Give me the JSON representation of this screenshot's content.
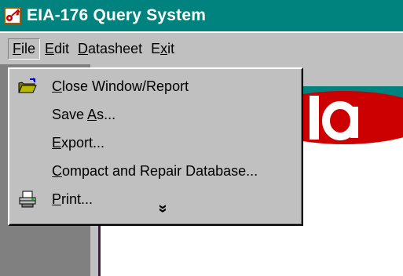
{
  "window": {
    "title": "EIA-176 Query System",
    "icon": "key-icon"
  },
  "menubar": {
    "items": [
      {
        "label_pre": "",
        "mnemonic": "F",
        "label_post": "ile",
        "active": true
      },
      {
        "label_pre": "",
        "mnemonic": "E",
        "label_post": "dit",
        "active": false
      },
      {
        "label_pre": "",
        "mnemonic": "D",
        "label_post": "atasheet",
        "active": false
      },
      {
        "label_pre": "E",
        "mnemonic": "x",
        "label_post": "it",
        "active": false
      }
    ]
  },
  "file_menu": {
    "items": [
      {
        "icon": "open-folder-icon",
        "label_pre": "",
        "mnemonic": "C",
        "label_post": "lose Window/Report"
      },
      {
        "icon": "",
        "label_pre": "Save ",
        "mnemonic": "A",
        "label_post": "s..."
      },
      {
        "icon": "",
        "label_pre": "",
        "mnemonic": "E",
        "label_post": "xport..."
      },
      {
        "icon": "",
        "label_pre": "",
        "mnemonic": "C",
        "label_post": "ompact and Repair Database..."
      },
      {
        "icon": "printer-icon",
        "label_pre": "",
        "mnemonic": "P",
        "label_post": "rint..."
      }
    ],
    "expand_glyph": "»"
  },
  "colors": {
    "titlebar": "#00837e",
    "chrome": "#c0c0c0",
    "desktop": "#808080",
    "logo_red": "#cc0000"
  }
}
